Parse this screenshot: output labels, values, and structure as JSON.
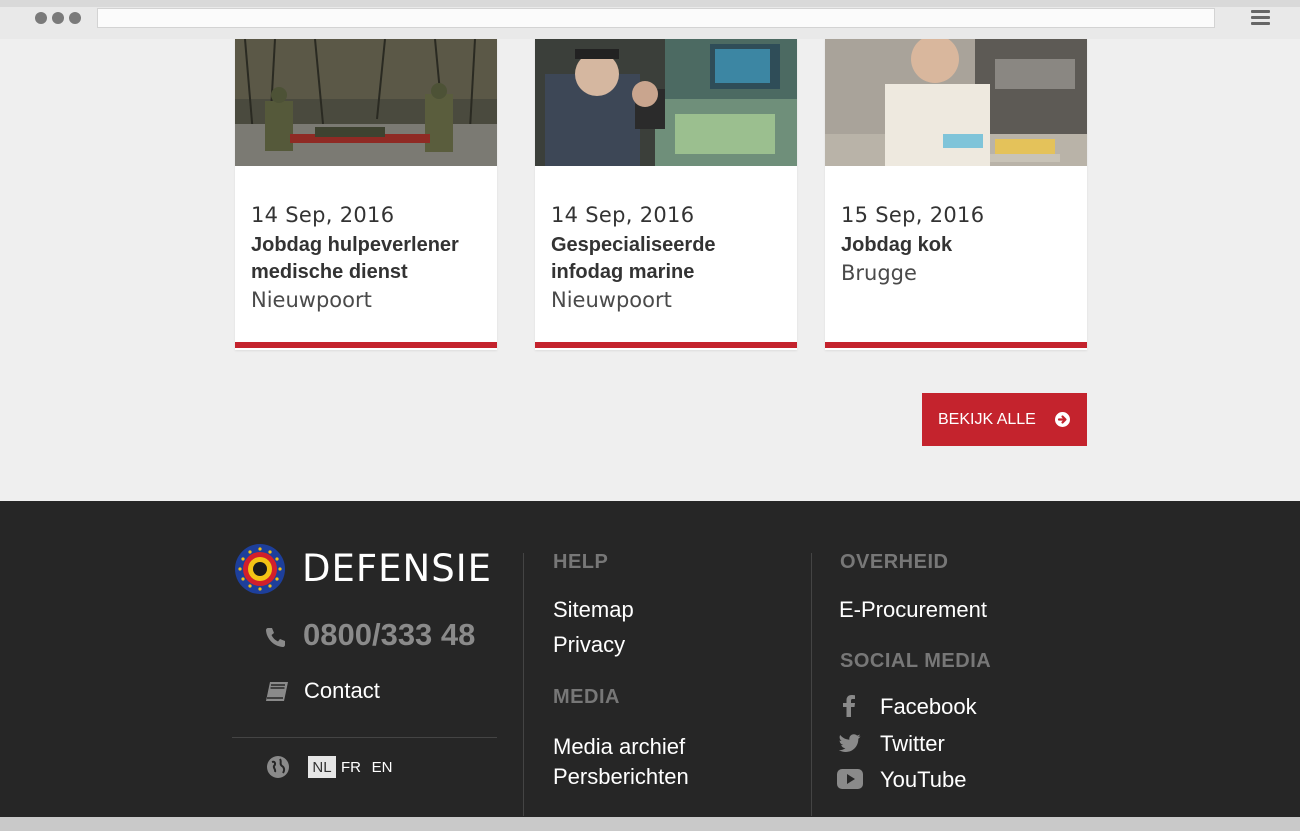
{
  "browser": {
    "url": ""
  },
  "events": [
    {
      "date": "14 Sep, 2016",
      "title_line1": "Jobdag hulpeverlener",
      "title_line2": "medische dienst",
      "place": "Nieuwpoort"
    },
    {
      "date": "14 Sep, 2016",
      "title_line1": "Gespecialiseerde",
      "title_line2": "infodag marine",
      "place": "Nieuwpoort"
    },
    {
      "date": "15 Sep, 2016",
      "title_line1": "Jobdag kok",
      "title_line2": "",
      "place": "Brugge"
    }
  ],
  "view_all_label": "BEKIJK ALLE",
  "footer": {
    "brand": "DEFENSIE",
    "phone": "0800/333 48",
    "contact": "Contact",
    "languages": [
      "NL",
      "FR",
      "EN"
    ],
    "active_language": "NL",
    "help": {
      "heading": "HELP",
      "links": [
        "Sitemap",
        "Privacy"
      ]
    },
    "media": {
      "heading": "MEDIA",
      "links": [
        "Media archief",
        "Persberichten"
      ]
    },
    "overheid": {
      "heading": "OVERHEID",
      "links": [
        "E-Procurement"
      ]
    },
    "social": {
      "heading": "SOCIAL MEDIA",
      "links": [
        "Facebook",
        "Twitter",
        "YouTube"
      ]
    }
  },
  "colors": {
    "accent_red": "#c4232d",
    "footer_bg": "#262626",
    "page_bg": "#efefef"
  },
  "icons": [
    "menu-icon",
    "phone-icon",
    "book-icon",
    "globe-icon",
    "arrow-circle-right-icon",
    "facebook-icon",
    "twitter-icon",
    "youtube-icon"
  ]
}
